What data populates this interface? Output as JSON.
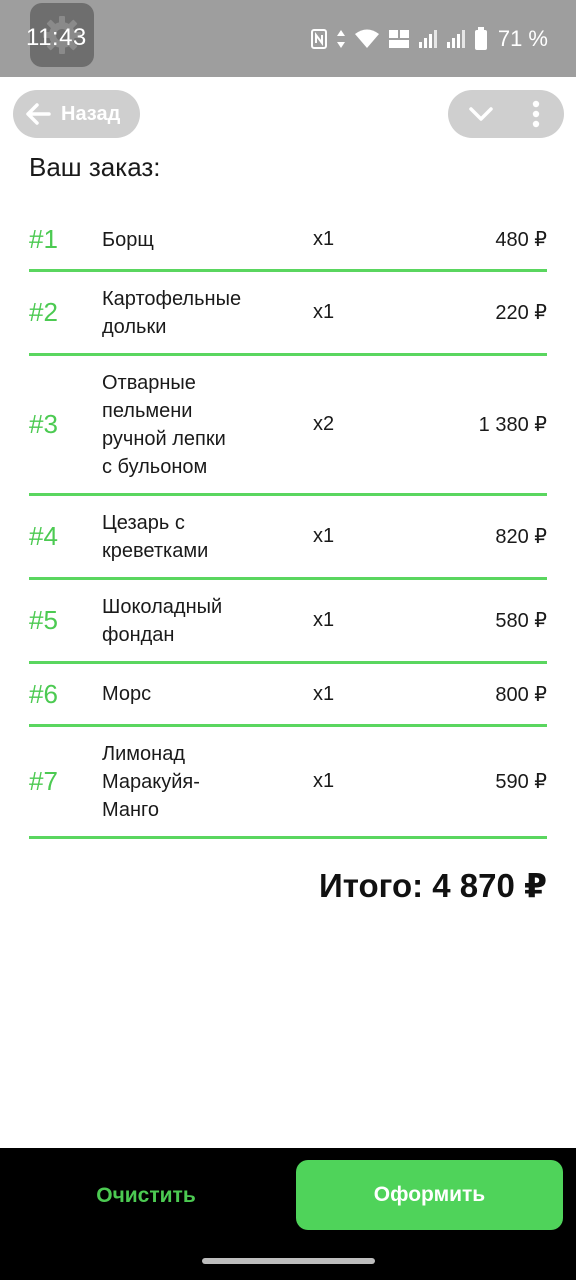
{
  "status_bar": {
    "time": "11:43",
    "battery_text": "71 %",
    "icons": [
      "settings-gear-icon",
      "nfc-icon",
      "data-arrows-icon",
      "wifi-icon",
      "volte-icon",
      "signal-icon",
      "signal-icon",
      "battery-icon"
    ]
  },
  "app_bar": {
    "back_label": "Назад",
    "icons": [
      "arrow-left-icon",
      "chevron-down-icon",
      "more-vertical-icon"
    ]
  },
  "page": {
    "title": "Ваш заказ:"
  },
  "orders": [
    {
      "num": "#1",
      "name": [
        "Борщ"
      ],
      "qty": "x1",
      "price": "480 ₽"
    },
    {
      "num": "#2",
      "name": [
        "Картофельные",
        "дольки"
      ],
      "qty": "x1",
      "price": "220 ₽"
    },
    {
      "num": "#3",
      "name": [
        "Отварные",
        "пельмени",
        "ручной лепки",
        "с бульоном"
      ],
      "qty": "x2",
      "price": "1 380 ₽"
    },
    {
      "num": "#4",
      "name": [
        "Цезарь с",
        "креветками"
      ],
      "qty": "x1",
      "price": "820 ₽"
    },
    {
      "num": "#5",
      "name": [
        "Шоколадный",
        "фондан"
      ],
      "qty": "x1",
      "price": "580 ₽"
    },
    {
      "num": "#6",
      "name": [
        "Морс"
      ],
      "qty": "x1",
      "price": "800 ₽"
    },
    {
      "num": "#7",
      "name": [
        "Лимонад",
        "Маракуйя-",
        "Манго"
      ],
      "qty": "x1",
      "price": "590 ₽"
    }
  ],
  "total": "Итого: 4 870 ₽",
  "actions": {
    "clear_label": "Очистить",
    "checkout_label": "Оформить"
  },
  "colors": {
    "accent": "#4fd35a",
    "status_bar": "#9e9e9e",
    "pill": "#cfcfcf"
  }
}
